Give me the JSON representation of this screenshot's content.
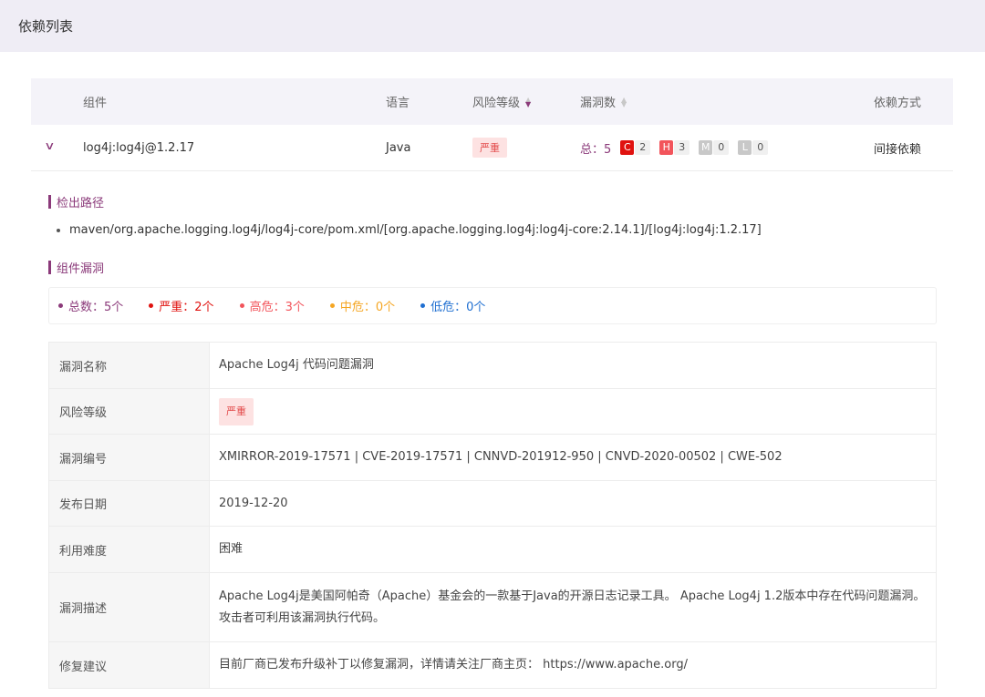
{
  "section": {
    "title": "依赖列表"
  },
  "table": {
    "headers": {
      "component": "组件",
      "language": "语言",
      "risk": "风险等级",
      "vuln_count": "漏洞数",
      "dep_type": "依赖方式"
    },
    "row": {
      "component": "log4j:log4j@1.2.17",
      "language": "Java",
      "risk": "严重",
      "total_label": "总：5",
      "counts": [
        {
          "letter": "C",
          "count": "2"
        },
        {
          "letter": "H",
          "count": "3"
        },
        {
          "letter": "M",
          "count": "0"
        },
        {
          "letter": "L",
          "count": "0"
        }
      ],
      "dep_type": "间接依赖"
    }
  },
  "detection": {
    "title": "检出路径",
    "path": "maven/org.apache.logging.log4j/log4j-core/pom.xml/[org.apache.logging.log4j:log4j-core:2.14.1]/[log4j:log4j:1.2.17]"
  },
  "vulns": {
    "title": "组件漏洞",
    "stats": [
      {
        "label": "总数：5个",
        "color": "#8b3a7a"
      },
      {
        "label": "严重：2个",
        "color": "#e0120f"
      },
      {
        "label": "高危：3个",
        "color": "#f2545b"
      },
      {
        "label": "中危：0个",
        "color": "#f5a623"
      },
      {
        "label": "低危：0个",
        "color": "#1f6fd1"
      }
    ],
    "detail": {
      "name_label": "漏洞名称",
      "name": "Apache Log4j 代码问题漏洞",
      "risk_label": "风险等级",
      "risk": "严重",
      "id_label": "漏洞编号",
      "ids": "XMIRROR-2019-17571 | CVE-2019-17571 | CNNVD-201912-950 | CNVD-2020-00502 | CWE-502",
      "date_label": "发布日期",
      "date": "2019-12-20",
      "difficulty_label": "利用难度",
      "difficulty": "困难",
      "desc_label": "漏洞描述",
      "desc": "Apache Log4j是美国阿帕奇（Apache）基金会的一款基于Java的开源日志记录工具。 Apache Log4j 1.2版本中存在代码问题漏洞。攻击者可利用该漏洞执行代码。",
      "fix_label": "修复建议",
      "fix": "目前厂商已发布升级补丁以修复漏洞，详情请关注厂商主页： https://www.apache.org/"
    }
  }
}
